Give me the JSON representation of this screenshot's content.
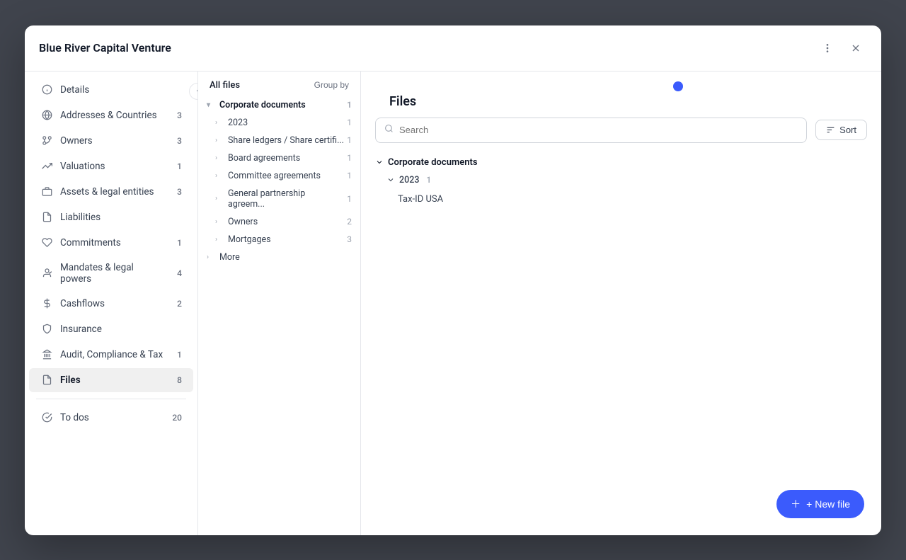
{
  "modal": {
    "title": "Blue River Capital Venture"
  },
  "sidebar": {
    "items": [
      {
        "id": "details",
        "label": "Details",
        "icon": "info",
        "badge": null
      },
      {
        "id": "addresses-countries",
        "label": "Addresses & Countries",
        "icon": "globe",
        "badge": "3"
      },
      {
        "id": "owners",
        "label": "Owners",
        "icon": "git-fork",
        "badge": "3"
      },
      {
        "id": "valuations",
        "label": "Valuations",
        "icon": "trending-up",
        "badge": "1"
      },
      {
        "id": "assets-legal",
        "label": "Assets & legal entities",
        "icon": "briefcase",
        "badge": "3"
      },
      {
        "id": "liabilities",
        "label": "Liabilities",
        "icon": "file-text",
        "badge": null
      },
      {
        "id": "commitments",
        "label": "Commitments",
        "icon": "heart",
        "badge": "1"
      },
      {
        "id": "mandates",
        "label": "Mandates & legal powers",
        "icon": "user-check",
        "badge": "4"
      },
      {
        "id": "cashflows",
        "label": "Cashflows",
        "icon": "dollar",
        "badge": "2"
      },
      {
        "id": "insurance",
        "label": "Insurance",
        "icon": "shield",
        "badge": null
      },
      {
        "id": "audit",
        "label": "Audit, Compliance & Tax",
        "icon": "bank",
        "badge": "1"
      },
      {
        "id": "files",
        "label": "Files",
        "icon": "file",
        "badge": "8",
        "active": true
      }
    ],
    "divider_after": 11,
    "todos": {
      "label": "To dos",
      "badge": "20",
      "icon": "check-circle"
    }
  },
  "files_panel": {
    "all_files_label": "All files",
    "group_by_label": "Group by",
    "sections": [
      {
        "label": "Corporate documents",
        "count": 1,
        "expanded": true,
        "children": [
          {
            "label": "2023",
            "count": 1,
            "indent": 1,
            "expanded": false
          },
          {
            "label": "Share ledgers / Share certifi...",
            "count": 1,
            "indent": 1
          },
          {
            "label": "Board agreements",
            "count": 1,
            "indent": 1
          },
          {
            "label": "Committee agreements",
            "count": 1,
            "indent": 1
          },
          {
            "label": "General partnership agreem...",
            "count": 1,
            "indent": 1
          },
          {
            "label": "Owners",
            "count": 2,
            "indent": 1
          },
          {
            "label": "Mortgages",
            "count": 3,
            "indent": 1
          }
        ]
      }
    ],
    "more_label": "More"
  },
  "main": {
    "files_title": "Files",
    "search_placeholder": "Search",
    "sort_label": "Sort",
    "file_tree": {
      "section": "Corporate documents",
      "year": "2023",
      "year_count": "1",
      "file": "Tax-ID USA"
    },
    "new_file_label": "+ New file"
  }
}
